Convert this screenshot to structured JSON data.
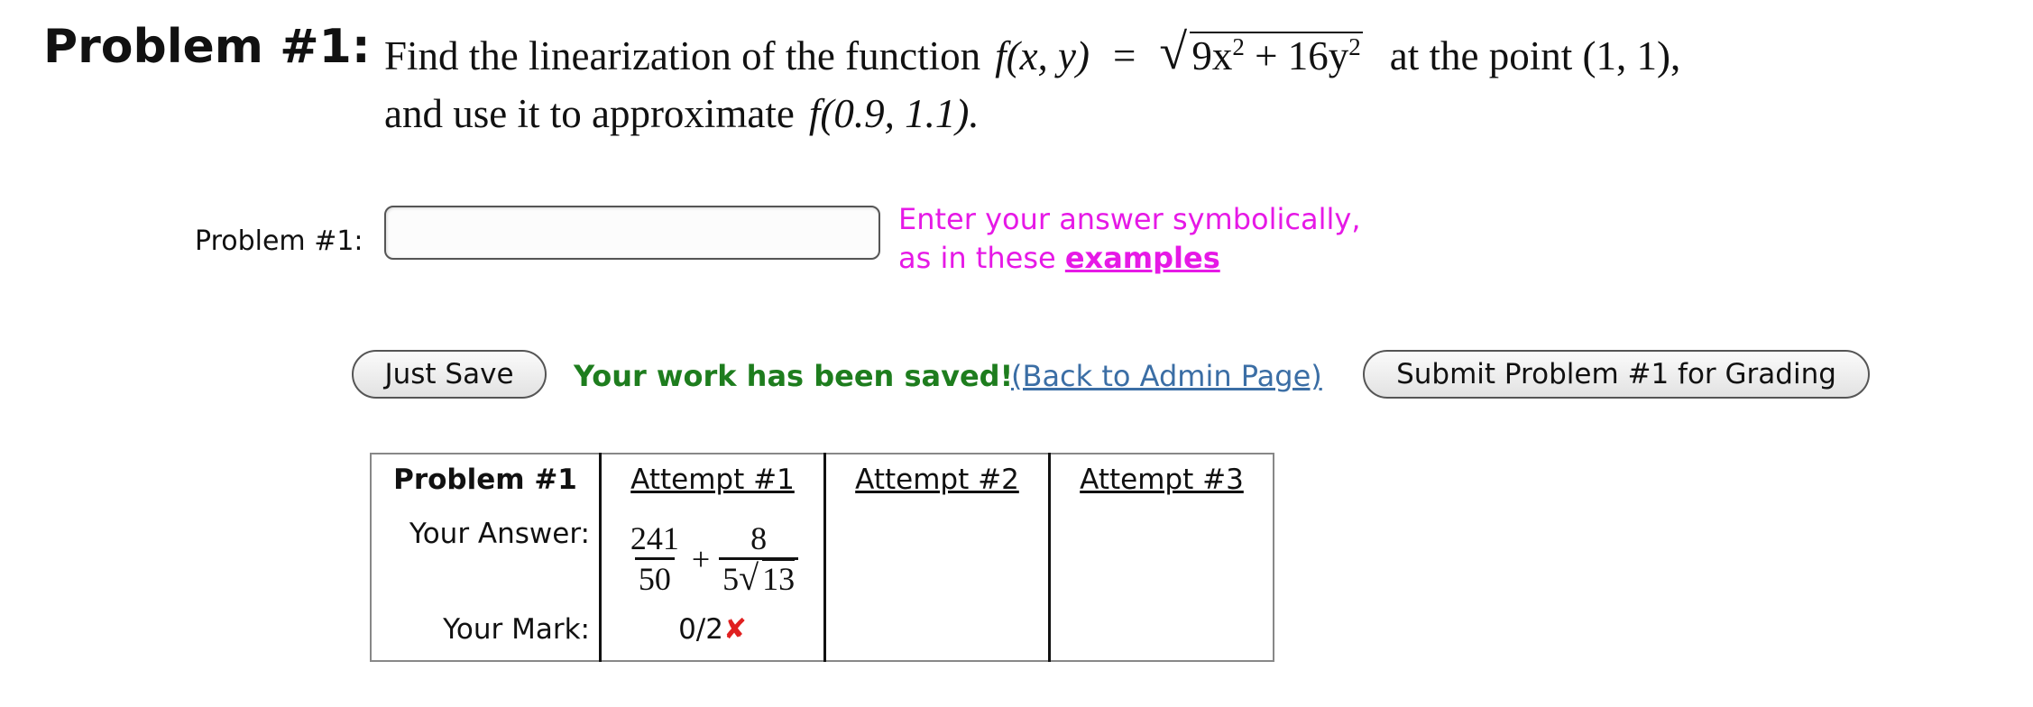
{
  "problem": {
    "heading": "Problem #1:",
    "text_before_function": "Find the linearization of the function",
    "function_lhs": "f(x, y)",
    "equals": "=",
    "radicand_part1": "9x",
    "radicand_exp1": "2",
    "radicand_plus": "+ 16y",
    "radicand_exp2": "2",
    "text_after_function": "at the point (1, 1),",
    "line2_text": "and use it to approximate",
    "approx_expr": "f(0.9, 1.1)."
  },
  "answer": {
    "label": "Problem #1:",
    "input_value": "",
    "input_placeholder": "",
    "hint_line1": "Enter your answer symbolically,",
    "hint_line2_prefix": "as in these",
    "hint_link": "examples"
  },
  "actions": {
    "just_save_label": "Just Save",
    "saved_message": "Your work has been saved!",
    "admin_link": "(Back to Admin Page)",
    "submit_label": "Submit Problem #1 for Grading"
  },
  "attempts": {
    "header_problem": "Problem #1",
    "headers": [
      "Attempt #1",
      "Attempt #2",
      "Attempt #3"
    ],
    "row_answer_label": "Your Answer:",
    "row_mark_label": "Your Mark:",
    "attempt1": {
      "frac1_num": "241",
      "frac1_den": "50",
      "plus": "+",
      "frac2_num": "8",
      "frac2_den_coef": "5",
      "frac2_den_radicand": "13",
      "mark": "0/2",
      "mark_icon": "✘"
    }
  },
  "colors": {
    "hint": "#e619e6",
    "saved": "#1e7d1e",
    "link": "#3b6ea5",
    "wrong": "#e02020"
  }
}
